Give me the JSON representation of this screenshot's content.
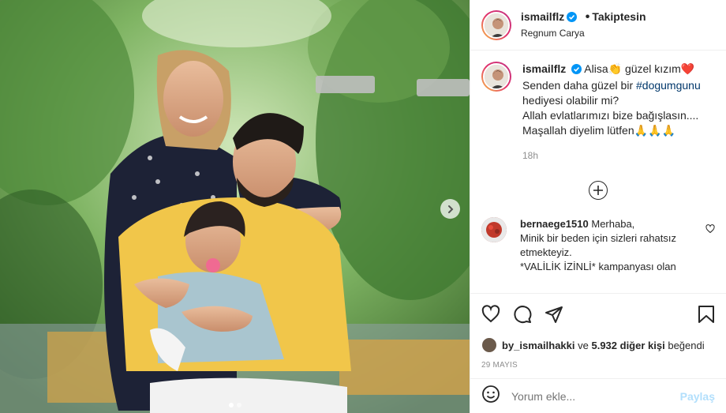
{
  "post": {
    "username": "ismailflz",
    "follow_status": "Takiptesin",
    "location": "Regnum Carya",
    "caption": {
      "username": "ismailflz",
      "line1_a": "Alisa",
      "line1_emoji1": "👏",
      "line1_b": "güzel kızım",
      "line1_emoji2": "❤️",
      "line2_a": "Senden daha güzel bir",
      "hashtag": "#dogumgunu",
      "line3": "hediyesi olabilir mi?",
      "line4": "Allah evlatlarımızı bize bağışlasın....",
      "line5_a": "Maşallah diyelim lütfen",
      "line5_emoji": "🙏🙏🙏"
    },
    "caption_time": "18h",
    "comments": [
      {
        "username": "bernaege1510",
        "text_line1": "Merhaba,",
        "text_line2": "Minik bir beden için sizleri rahatsız",
        "text_line3": "etmekteyiz.",
        "text_line4": "*VALİLİK İZİNLİ* kampanyası olan"
      }
    ],
    "likes": {
      "user": "by_ismailhakki",
      "joiner": "ve",
      "others": "5.932 diğer kişi",
      "suffix": "beğendi"
    },
    "date": "29 MAYIS",
    "add_comment": {
      "placeholder": "Yorum ekle...",
      "post_label": "Paylaş"
    },
    "carousel": {
      "count": 2,
      "active": 0
    }
  },
  "colors": {
    "verified": "#0095f6",
    "hashtag": "#00376b",
    "post_disabled": "#b2dffc"
  }
}
